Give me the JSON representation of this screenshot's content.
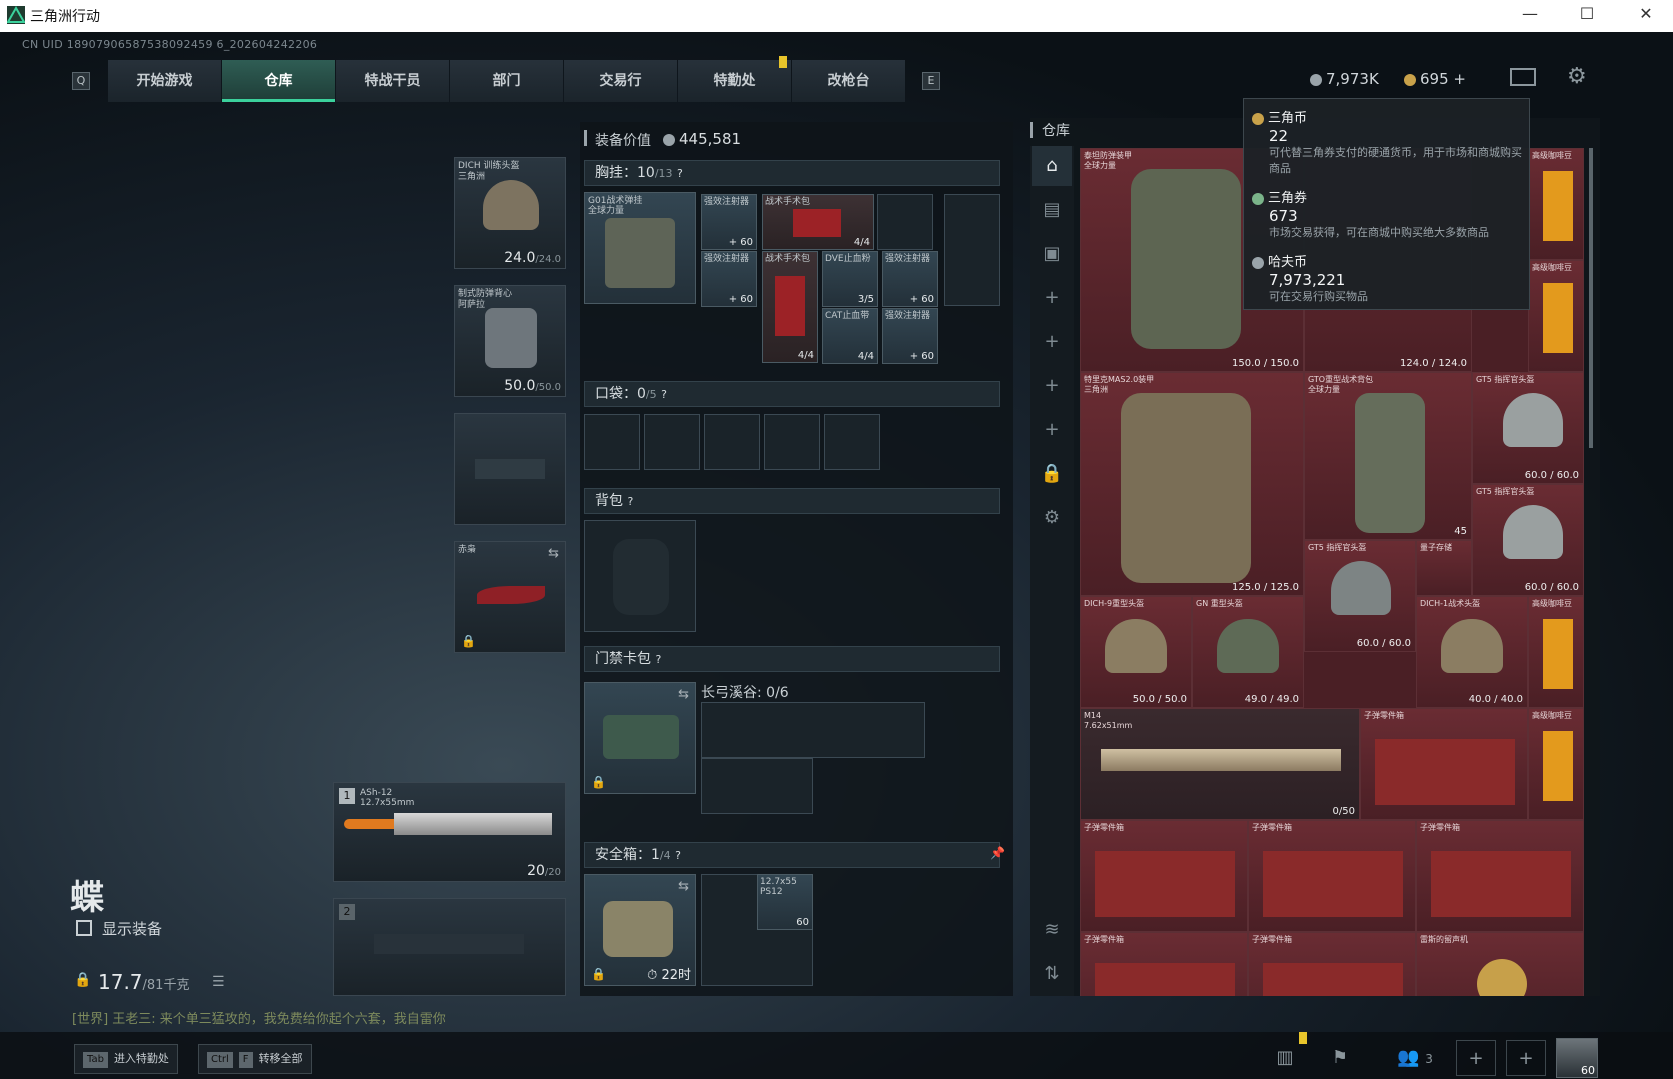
{
  "window": {
    "title": "三角洲行动",
    "min": "—",
    "max": "☐",
    "close": "✕"
  },
  "uid": "CN UID 18907906587538092459 6_202604242206",
  "nav": {
    "left_key": "Q",
    "right_key": "E",
    "tabs": [
      "开始游戏",
      "仓库",
      "特战干员",
      "部门",
      "交易行",
      "特勤处",
      "改枪台"
    ],
    "active": "仓库"
  },
  "currency": {
    "silver": "7,973K",
    "gold": "695",
    "plus": "+"
  },
  "gear": {
    "helmet": {
      "name": "DICH 训练头盔",
      "sub": "三角洲",
      "dur": "24.0",
      "max": "/24.0"
    },
    "armor": {
      "name": "制式防弹背心",
      "sub": "阿萨拉",
      "dur": "50.0",
      "max": "/50.0"
    },
    "melee": {
      "name": "赤枭"
    },
    "primary": {
      "index": "1",
      "name": "ASh-12",
      "ammo_type": "12.7x55mm",
      "ammo": "20",
      "ammo_max": "/20"
    },
    "secondary": {
      "index": "2"
    }
  },
  "operator": {
    "name": "蝶",
    "show_gear": "显示装备",
    "weight": "17.7",
    "weight_max": "/81千克"
  },
  "chat": "[世界] 王老三: 来个单三猛攻的，我免费给你起个六套，我自雷你",
  "middle": {
    "value_label": "装备价值",
    "value": "445,581",
    "chest": {
      "label": "胸挂：",
      "used": "10",
      "cap": "/13",
      "help": "?"
    },
    "chest_item": {
      "name": "G01战术弹挂",
      "sub": "全球力量"
    },
    "chest_items": [
      {
        "name": "强效注射器",
        "qty": "+ 60"
      },
      {
        "name": "战术手术包",
        "qty": "4/4"
      },
      {
        "name": "强效注射器",
        "qty": "+ 60"
      },
      {
        "name": "战术手术包",
        "qty": "4/4"
      },
      {
        "name": "DVE止血粉",
        "qty": "3/5"
      },
      {
        "name": "强效注射器",
        "qty": "+ 60"
      },
      {
        "name": "CAT止血带",
        "qty": "4/4"
      },
      {
        "name": "强效注射器",
        "qty": "+ 60"
      }
    ],
    "pocket": {
      "label": "口袋：",
      "used": "0",
      "cap": "/5",
      "help": "?"
    },
    "backpack": {
      "label": "背包",
      "help": "?"
    },
    "keycard": {
      "label": "门禁卡包",
      "help": "?",
      "map": "长弓溪谷: 0/6"
    },
    "safebox": {
      "label": "安全箱：",
      "used": "1",
      "cap": "/4",
      "help": "?",
      "timer": "22时",
      "ammo_name": "12.7x55",
      "ammo_sub": "PS12",
      "ammo_qty": "60"
    }
  },
  "stash": {
    "title": "仓库",
    "items": [
      {
        "name": "泰坦防弹装甲",
        "sub": "全球力量",
        "dur": "150.0 / 150.0"
      },
      {
        "name": "高级咖啡豆",
        "sub": ""
      },
      {
        "name": "高级咖啡豆",
        "sub": ""
      },
      {
        "name": "",
        "sub": "",
        "dur": "124.0 / 124.0"
      },
      {
        "name": "特里克MAS2.0装甲",
        "sub": "三角洲",
        "dur": "125.0 / 125.0"
      },
      {
        "name": "GTO重型战术背包",
        "sub": "全球力量",
        "dur": "45"
      },
      {
        "name": "GT5 指挥官头盔",
        "sub": "全球力量",
        "dur": "60.0 / 60.0"
      },
      {
        "name": "GT5 指挥官头盔",
        "sub": "全球力量",
        "dur": "60.0 / 60.0"
      },
      {
        "name": "DICH-9重型头盔",
        "sub": "三角洲",
        "dur": "50.0 / 50.0"
      },
      {
        "name": "GN 重型头盔",
        "sub": "全球力量",
        "dur": "49.0 / 49.0"
      },
      {
        "name": "GT5 指挥官头盔",
        "sub": "全球力量",
        "dur": "60.0 / 60.0"
      },
      {
        "name": "量子存储",
        "sub": ""
      },
      {
        "name": "DICH-1战术头盔",
        "sub": "三角洲",
        "dur": "40.0 / 40.0"
      },
      {
        "name": "高级咖啡豆",
        "sub": ""
      },
      {
        "name": "M14",
        "sub": "7.62x51mm",
        "dur": "0/50"
      },
      {
        "name": "子弹零件箱",
        "sub": ""
      },
      {
        "name": "高级咖啡豆",
        "sub": ""
      },
      {
        "name": "子弹零件箱",
        "sub": ""
      },
      {
        "name": "子弹零件箱",
        "sub": ""
      },
      {
        "name": "子弹零件箱",
        "sub": ""
      },
      {
        "name": "子弹零件箱",
        "sub": ""
      },
      {
        "name": "子弹零件箱",
        "sub": ""
      },
      {
        "name": "雷斯的留声机",
        "sub": ""
      }
    ]
  },
  "tooltip": {
    "c1": {
      "name": "三角币",
      "value": "22",
      "desc": "可代替三角券支付的硬通货币，用于市场和商城购买商品"
    },
    "c2": {
      "name": "三角券",
      "value": "673",
      "desc": "市场交易获得，可在商城中购买绝大多数商品"
    },
    "c3": {
      "name": "哈夫币",
      "value": "7,973,221",
      "desc": "可在交易行购买物品"
    }
  },
  "bottom": {
    "tab_key": "Tab",
    "tab_label": "进入特勤处",
    "ctrl_key": "Ctrl",
    "f_key": "F",
    "transfer_label": "转移全部",
    "team_count": "3",
    "level": "60"
  },
  "colors": {
    "accent": "#3bd19c",
    "stash_bg": "#6a2c33",
    "gold": "#e8c52b"
  }
}
